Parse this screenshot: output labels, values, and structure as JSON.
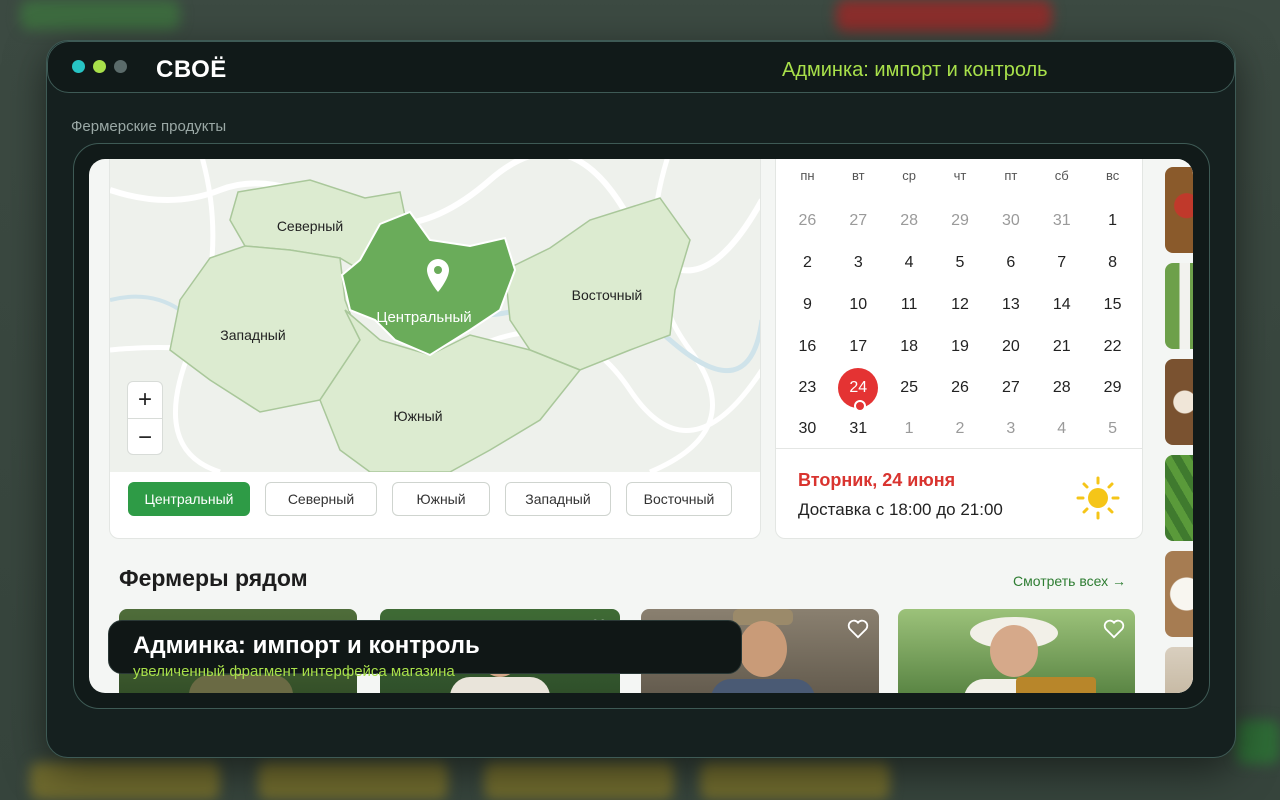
{
  "window": {
    "brand": "СВОЁ",
    "title": "Админка: импорт и контроль",
    "traffic_colors": [
      "#27c4c4",
      "#a8e04a",
      "#5b6b6a"
    ]
  },
  "section_label": "Фермерские продукты",
  "map": {
    "districts": [
      "Северный",
      "Центральный",
      "Восточный",
      "Западный",
      "Южный"
    ],
    "zoom_in": "+",
    "zoom_out": "−",
    "chips": [
      {
        "label": "Центральный",
        "active": true
      },
      {
        "label": "Северный",
        "active": false
      },
      {
        "label": "Южный",
        "active": false
      },
      {
        "label": "Западный",
        "active": false
      },
      {
        "label": "Восточный",
        "active": false
      }
    ],
    "active_color": "#2e9b46"
  },
  "calendar": {
    "weekdays": [
      "пн",
      "вт",
      "ср",
      "чт",
      "пт",
      "сб",
      "вс"
    ],
    "weeks": [
      [
        "26",
        "27",
        "28",
        "29",
        "30",
        "31",
        "1"
      ],
      [
        "2",
        "3",
        "4",
        "5",
        "6",
        "7",
        "8"
      ],
      [
        "9",
        "10",
        "11",
        "12",
        "13",
        "14",
        "15"
      ],
      [
        "16",
        "17",
        "18",
        "19",
        "20",
        "21",
        "22"
      ],
      [
        "23",
        "24",
        "25",
        "26",
        "27",
        "28",
        "29"
      ],
      [
        "30",
        "31",
        "1",
        "2",
        "3",
        "4",
        "5"
      ]
    ],
    "selected_day": "24",
    "selected_date": "Вторник, 24 июня",
    "delivery": "Доставка с 18:00 до 21:00",
    "accent": "#e43333",
    "weather_icon": "sun-icon"
  },
  "farmers": {
    "heading": "Фермеры рядом",
    "see_all": "Смотреть всех"
  },
  "caption": {
    "title": "Админка: импорт и контроль",
    "subtitle": "увеличенный фрагмент интерфейса магазина"
  }
}
